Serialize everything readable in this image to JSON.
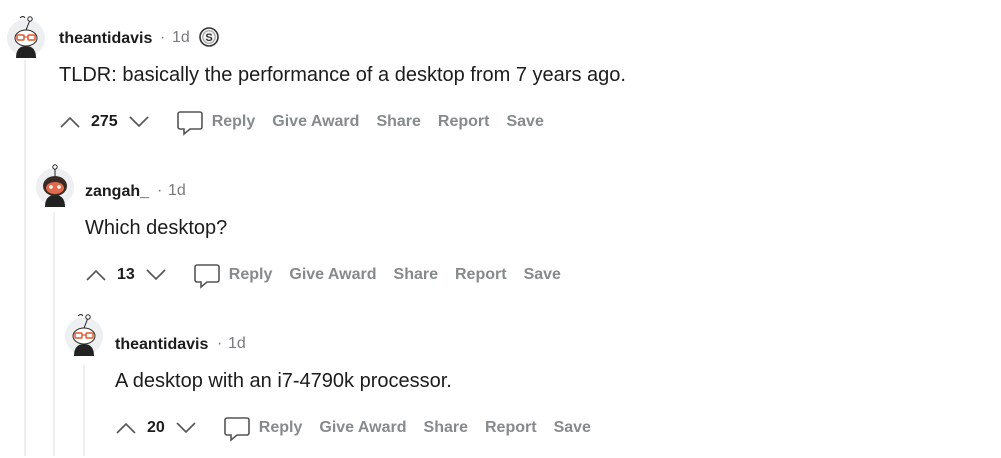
{
  "comments": [
    {
      "username": "theantidavis",
      "separator": "·",
      "time": "1d",
      "has_award": true,
      "award_icon": "silver-award-icon",
      "body": "TLDR: basically the performance of a desktop from 7 years ago.",
      "score": "275",
      "actions": {
        "reply": "Reply",
        "give_award": "Give Award",
        "share": "Share",
        "report": "Report",
        "save": "Save"
      }
    },
    {
      "username": "zangah_",
      "separator": "·",
      "time": "1d",
      "has_award": false,
      "body": "Which desktop?",
      "score": "13",
      "actions": {
        "reply": "Reply",
        "give_award": "Give Award",
        "share": "Share",
        "report": "Report",
        "save": "Save"
      }
    },
    {
      "username": "theantidavis",
      "separator": "·",
      "time": "1d",
      "has_award": false,
      "body": "A desktop with an i7-4790k processor.",
      "score": "20",
      "actions": {
        "reply": "Reply",
        "give_award": "Give Award",
        "share": "Share",
        "report": "Report",
        "save": "Save"
      }
    }
  ],
  "colors": {
    "meta": "#787c7e",
    "action": "#878a8c",
    "thread_line": "#edeff1",
    "text": "#1c1c1c"
  }
}
